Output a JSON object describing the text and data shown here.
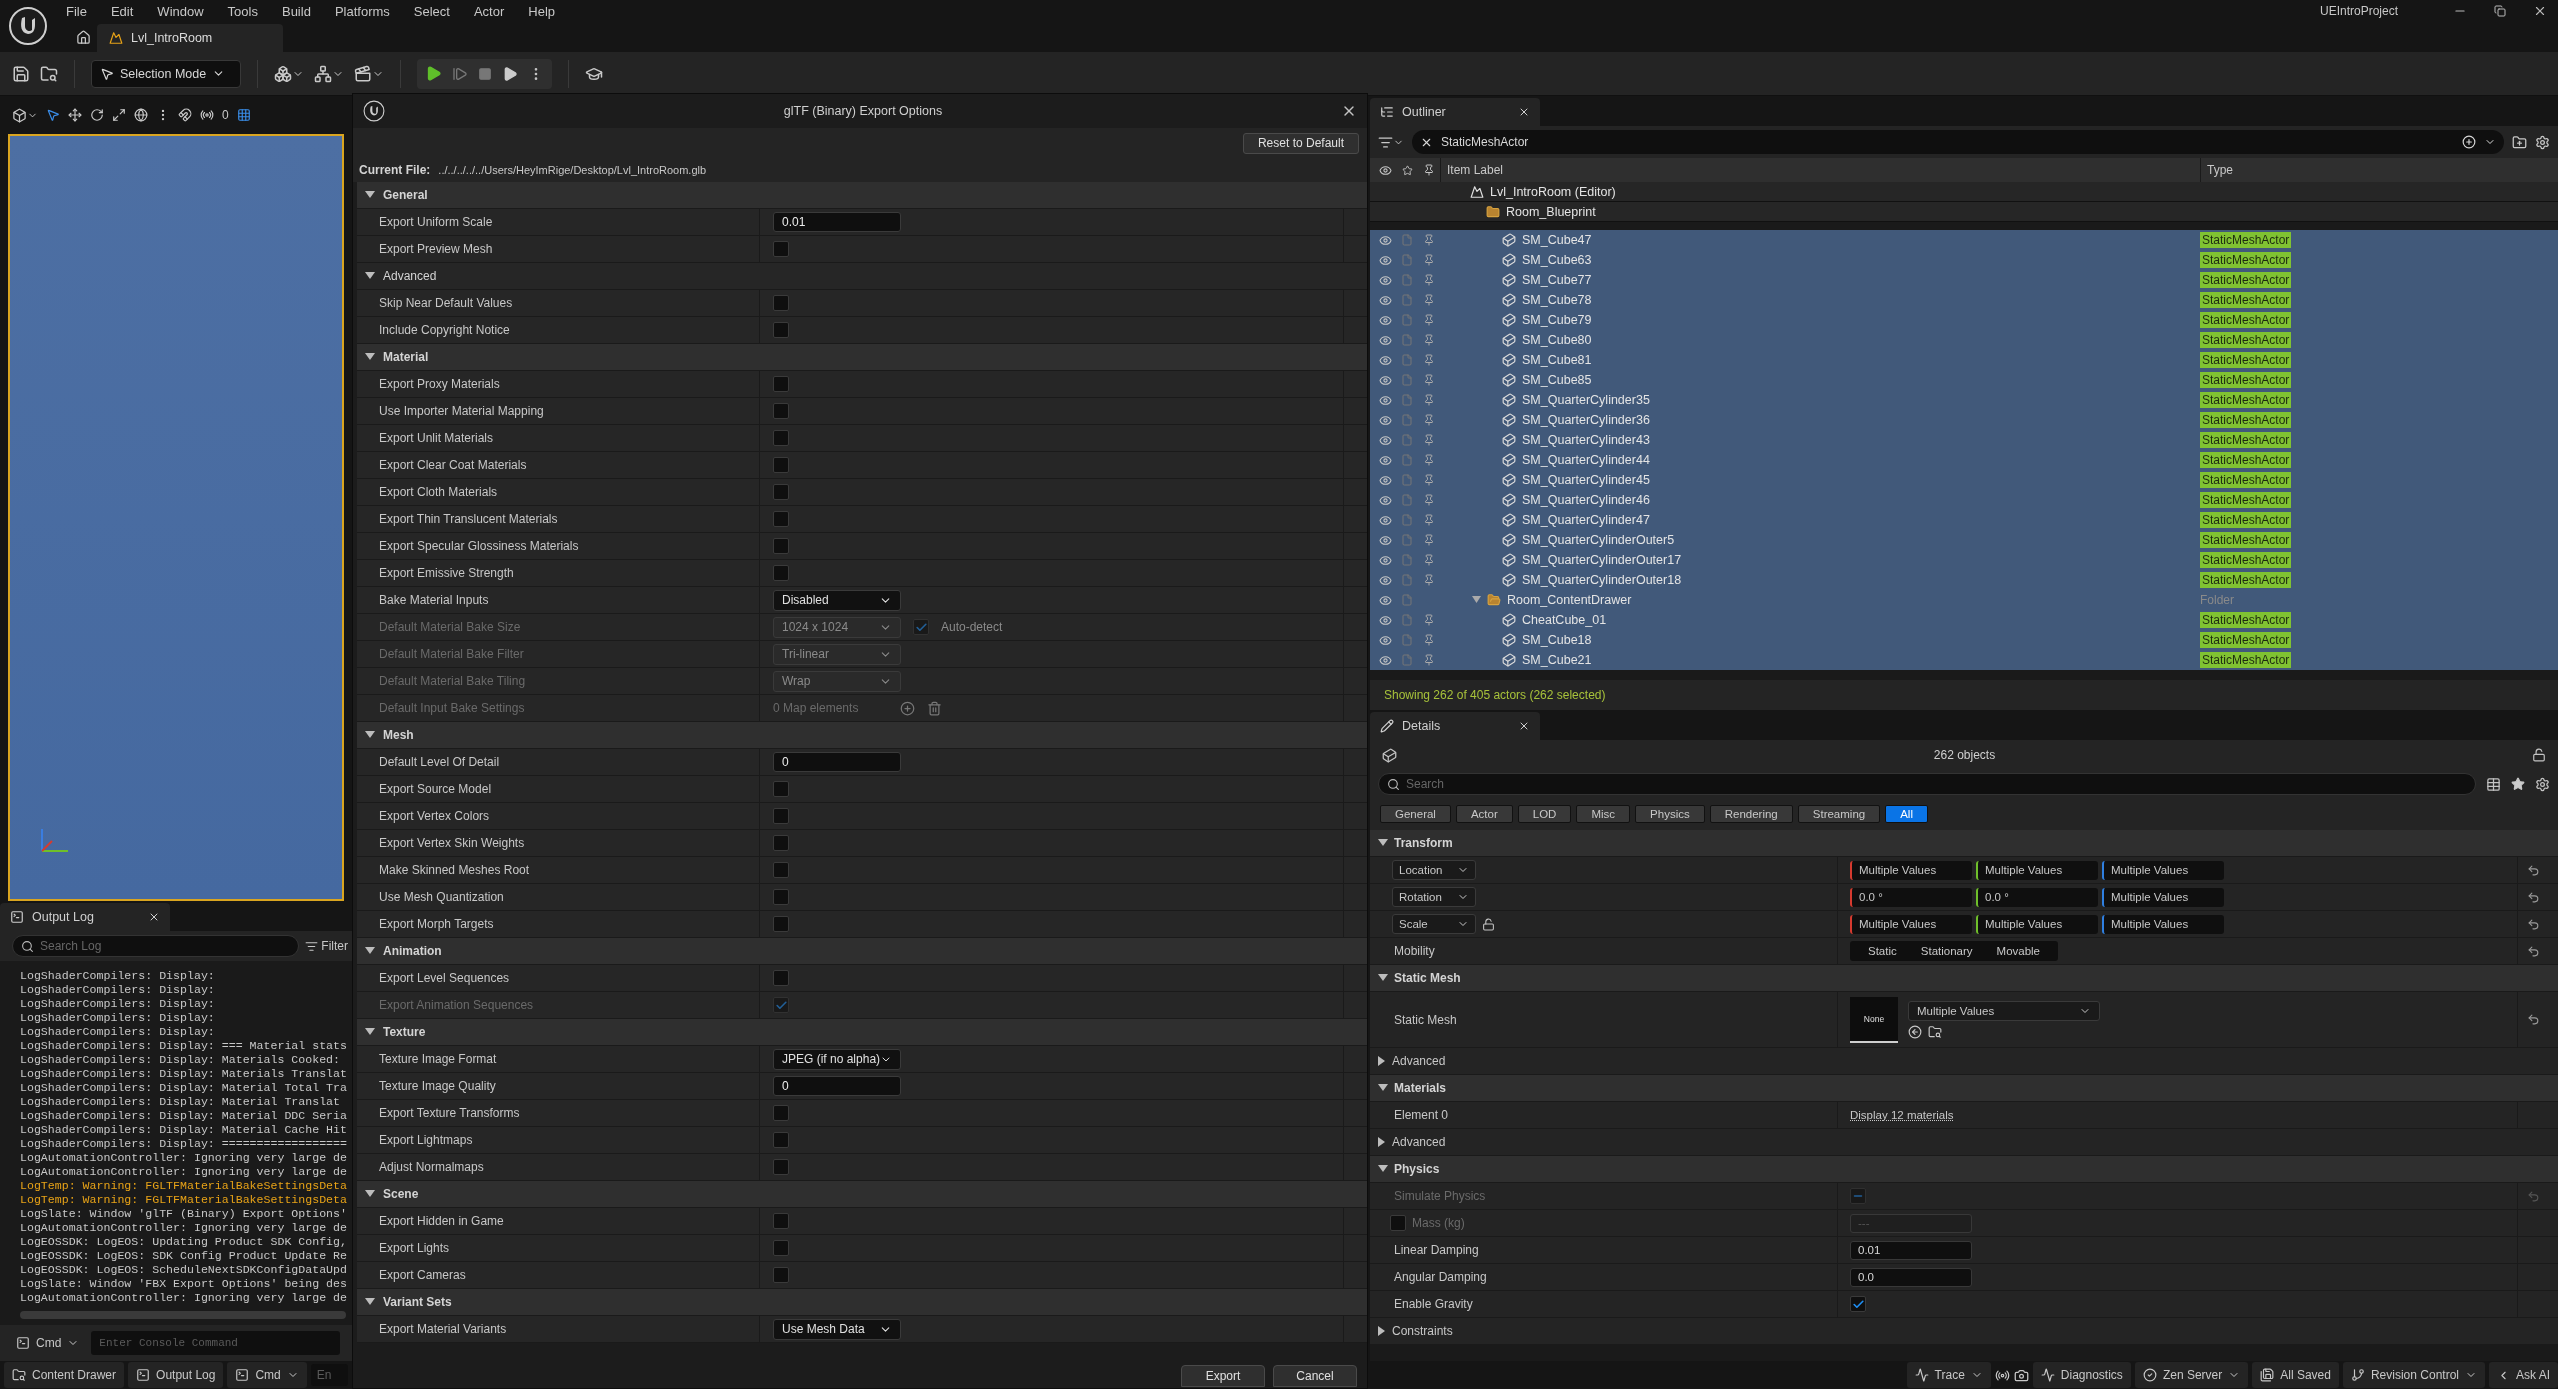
{
  "menu": [
    "File",
    "Edit",
    "Window",
    "Tools",
    "Build",
    "Platforms",
    "Select",
    "Actor",
    "Help"
  ],
  "project_title": "UEIntroProject",
  "level_tab": {
    "label": "Lvl_IntroRoom"
  },
  "toolbar": {
    "mode": "Selection Mode"
  },
  "viewport": {
    "snap_value": "0"
  },
  "output_log": {
    "title": "Output Log",
    "search_placeholder": "Search Log",
    "filter": "Filter",
    "cmd": "Cmd",
    "console_placeholder": "Enter Console Command",
    "lines": [
      {
        "kind": "info",
        "text": "LogShaderCompilers: Display:"
      },
      {
        "kind": "info",
        "text": "LogShaderCompilers: Display:"
      },
      {
        "kind": "info",
        "text": "LogShaderCompilers: Display:"
      },
      {
        "kind": "info",
        "text": "LogShaderCompilers: Display:"
      },
      {
        "kind": "info",
        "text": "LogShaderCompilers: Display:"
      },
      {
        "kind": "info",
        "text": "LogShaderCompilers: Display: === Material stats"
      },
      {
        "kind": "info",
        "text": "LogShaderCompilers: Display: Materials Cooked:"
      },
      {
        "kind": "info",
        "text": "LogShaderCompilers: Display: Materials Translat"
      },
      {
        "kind": "info",
        "text": "LogShaderCompilers: Display: Material Total Tra"
      },
      {
        "kind": "info",
        "text": "LogShaderCompilers: Display: Material Translat"
      },
      {
        "kind": "info",
        "text": "LogShaderCompilers: Display: Material DDC Seria"
      },
      {
        "kind": "info",
        "text": "LogShaderCompilers: Display: Material Cache Hit"
      },
      {
        "kind": "info",
        "text": "LogShaderCompilers: Display: =================="
      },
      {
        "kind": "info",
        "text": "LogAutomationController: Ignoring very large de"
      },
      {
        "kind": "info",
        "text": "LogAutomationController: Ignoring very large de"
      },
      {
        "kind": "warning",
        "text": "LogTemp: Warning: FGLTFMaterialBakeSettingsDeta"
      },
      {
        "kind": "warning",
        "text": "LogTemp: Warning: FGLTFMaterialBakeSettingsDeta"
      },
      {
        "kind": "info",
        "text": "LogSlate: Window 'glTF (Binary) Export Options'"
      },
      {
        "kind": "info",
        "text": "LogAutomationController: Ignoring very large de"
      },
      {
        "kind": "info",
        "text": "LogEOSSDK: LogEOS: Updating Product SDK Config,"
      },
      {
        "kind": "info",
        "text": "LogEOSSDK: LogEOS: SDK Config Product Update Re"
      },
      {
        "kind": "info",
        "text": "LogEOSSDK: LogEOS: ScheduleNextSDKConfigDataUpd"
      },
      {
        "kind": "info",
        "text": "LogSlate: Window 'FBX Export Options' being des"
      },
      {
        "kind": "info",
        "text": "LogAutomationController: Ignoring very large de"
      }
    ]
  },
  "dialog": {
    "title": "glTF (Binary) Export Options",
    "reset": "Reset to Default",
    "current_file_label": "Current File:",
    "current_file": "../../../../../Users/HeyImRige/Desktop/Lvl_IntroRoom.glb",
    "rows": [
      {
        "kind": "section",
        "label": "General"
      },
      {
        "kind": "text",
        "label": "Export Uniform Scale",
        "value": "0.01",
        "disabled": false
      },
      {
        "kind": "check",
        "label": "Export Preview Mesh",
        "checked": false,
        "disabled": false
      },
      {
        "kind": "subsection",
        "label": "Advanced"
      },
      {
        "kind": "check",
        "label": "Skip Near Default Values",
        "checked": false,
        "disabled": false
      },
      {
        "kind": "check",
        "label": "Include Copyright Notice",
        "checked": false,
        "disabled": false
      },
      {
        "kind": "section",
        "label": "Material"
      },
      {
        "kind": "check",
        "label": "Export Proxy Materials",
        "checked": false,
        "disabled": false
      },
      {
        "kind": "check",
        "label": "Use Importer Material Mapping",
        "checked": false,
        "disabled": false
      },
      {
        "kind": "check",
        "label": "Export Unlit Materials",
        "checked": false,
        "disabled": false
      },
      {
        "kind": "check",
        "label": "Export Clear Coat Materials",
        "checked": false,
        "disabled": false
      },
      {
        "kind": "check",
        "label": "Export Cloth Materials",
        "checked": false,
        "disabled": false
      },
      {
        "kind": "check",
        "label": "Export Thin Translucent Materials",
        "checked": false,
        "disabled": false
      },
      {
        "kind": "check",
        "label": "Export Specular Glossiness Materials",
        "checked": false,
        "disabled": false
      },
      {
        "kind": "check",
        "label": "Export Emissive Strength",
        "checked": false,
        "disabled": false
      },
      {
        "kind": "select",
        "label": "Bake Material Inputs",
        "value": "Disabled",
        "disabled": false
      },
      {
        "kind": "select_auto",
        "label": "Default Material Bake Size",
        "value": "1024 x 1024",
        "auto_label": "Auto-detect",
        "auto_checked": true,
        "disabled": true
      },
      {
        "kind": "select",
        "label": "Default Material Bake Filter",
        "value": "Tri-linear",
        "disabled": true
      },
      {
        "kind": "select",
        "label": "Default Material Bake Tiling",
        "value": "Wrap",
        "disabled": true
      },
      {
        "kind": "map",
        "label": "Default Input Bake Settings",
        "value": "0 Map elements",
        "disabled": true
      },
      {
        "kind": "section",
        "label": "Mesh"
      },
      {
        "kind": "text",
        "label": "Default Level Of Detail",
        "value": "0",
        "disabled": false
      },
      {
        "kind": "check",
        "label": "Export Source Model",
        "checked": false,
        "disabled": false
      },
      {
        "kind": "check",
        "label": "Export Vertex Colors",
        "checked": false,
        "disabled": false
      },
      {
        "kind": "check",
        "label": "Export Vertex Skin Weights",
        "checked": false,
        "disabled": false
      },
      {
        "kind": "check",
        "label": "Make Skinned Meshes Root",
        "checked": false,
        "disabled": false
      },
      {
        "kind": "check",
        "label": "Use Mesh Quantization",
        "checked": false,
        "disabled": false
      },
      {
        "kind": "check",
        "label": "Export Morph Targets",
        "checked": false,
        "disabled": false
      },
      {
        "kind": "section",
        "label": "Animation"
      },
      {
        "kind": "check",
        "label": "Export Level Sequences",
        "checked": false,
        "disabled": false
      },
      {
        "kind": "check",
        "label": "Export Animation Sequences",
        "checked": true,
        "disabled": true
      },
      {
        "kind": "section",
        "label": "Texture"
      },
      {
        "kind": "select",
        "label": "Texture Image Format",
        "value": "JPEG (if no alpha)",
        "disabled": false
      },
      {
        "kind": "text",
        "label": "Texture Image Quality",
        "value": "0",
        "disabled": false
      },
      {
        "kind": "check",
        "label": "Export Texture Transforms",
        "checked": false,
        "disabled": false
      },
      {
        "kind": "check",
        "label": "Export Lightmaps",
        "checked": false,
        "disabled": false
      },
      {
        "kind": "check",
        "label": "Adjust Normalmaps",
        "checked": false,
        "disabled": false
      },
      {
        "kind": "section",
        "label": "Scene"
      },
      {
        "kind": "check",
        "label": "Export Hidden in Game",
        "checked": false,
        "disabled": false
      },
      {
        "kind": "check",
        "label": "Export Lights",
        "checked": false,
        "disabled": false
      },
      {
        "kind": "check",
        "label": "Export Cameras",
        "checked": false,
        "disabled": false
      },
      {
        "kind": "section",
        "label": "Variant Sets"
      },
      {
        "kind": "select",
        "label": "Export Material Variants",
        "value": "Use Mesh Data",
        "disabled": false
      }
    ],
    "buttons": [
      "Export",
      "Cancel"
    ]
  },
  "outliner": {
    "title": "Outliner",
    "search": "StaticMeshActor",
    "columns": [
      "Item Label",
      "Type"
    ],
    "tree": [
      {
        "kind": "level",
        "label": "Lvl_IntroRoom (Editor)",
        "selected": false,
        "children": [
          {
            "kind": "folder",
            "label": "Room_Blueprint",
            "selected": false,
            "children": [
              {
                "kind": "actor",
                "label": "SM_Cube47",
                "type": "StaticMeshActor",
                "selected": true
              },
              {
                "kind": "actor",
                "label": "SM_Cube63",
                "type": "StaticMeshActor",
                "selected": true
              },
              {
                "kind": "actor",
                "label": "SM_Cube77",
                "type": "StaticMeshActor",
                "selected": true
              },
              {
                "kind": "actor",
                "label": "SM_Cube78",
                "type": "StaticMeshActor",
                "selected": true
              },
              {
                "kind": "actor",
                "label": "SM_Cube79",
                "type": "StaticMeshActor",
                "selected": true
              },
              {
                "kind": "actor",
                "label": "SM_Cube80",
                "type": "StaticMeshActor",
                "selected": true
              },
              {
                "kind": "actor",
                "label": "SM_Cube81",
                "type": "StaticMeshActor",
                "selected": true
              },
              {
                "kind": "actor",
                "label": "SM_Cube85",
                "type": "StaticMeshActor",
                "selected": true
              },
              {
                "kind": "actor",
                "label": "SM_QuarterCylinder35",
                "type": "StaticMeshActor",
                "selected": true
              },
              {
                "kind": "actor",
                "label": "SM_QuarterCylinder36",
                "type": "StaticMeshActor",
                "selected": true
              },
              {
                "kind": "actor",
                "label": "SM_QuarterCylinder43",
                "type": "StaticMeshActor",
                "selected": true
              },
              {
                "kind": "actor",
                "label": "SM_QuarterCylinder44",
                "type": "StaticMeshActor",
                "selected": true
              },
              {
                "kind": "actor",
                "label": "SM_QuarterCylinder45",
                "type": "StaticMeshActor",
                "selected": true
              },
              {
                "kind": "actor",
                "label": "SM_QuarterCylinder46",
                "type": "StaticMeshActor",
                "selected": true
              },
              {
                "kind": "actor",
                "label": "SM_QuarterCylinder47",
                "type": "StaticMeshActor",
                "selected": true
              },
              {
                "kind": "actor",
                "label": "SM_QuarterCylinderOuter5",
                "type": "StaticMeshActor",
                "selected": true
              },
              {
                "kind": "actor",
                "label": "SM_QuarterCylinderOuter17",
                "type": "StaticMeshActor",
                "selected": true
              },
              {
                "kind": "actor",
                "label": "SM_QuarterCylinderOuter18",
                "type": "StaticMeshActor",
                "selected": true
              }
            ]
          },
          {
            "kind": "folder",
            "label": "Room_ContentDrawer",
            "type": "Folder",
            "expanded": true,
            "selected": true,
            "children": [
              {
                "kind": "actor",
                "label": "CheatCube_01",
                "type": "StaticMeshActor",
                "selected": true
              },
              {
                "kind": "actor",
                "label": "SM_Cube18",
                "type": "StaticMeshActor",
                "selected": true
              },
              {
                "kind": "actor",
                "label": "SM_Cube21",
                "type": "StaticMeshActor",
                "selected": true
              }
            ]
          }
        ]
      }
    ],
    "status": "Showing 262 of 405 actors (262 selected)"
  },
  "details": {
    "title": "Details",
    "count": "262 objects",
    "search_placeholder": "Search",
    "filters": [
      {
        "label": "General",
        "selected": false
      },
      {
        "label": "Actor",
        "selected": false
      },
      {
        "label": "LOD",
        "selected": false
      },
      {
        "label": "Misc",
        "selected": false
      },
      {
        "label": "Physics",
        "selected": false
      },
      {
        "label": "Rendering",
        "selected": false
      },
      {
        "label": "Streaming",
        "selected": false
      },
      {
        "label": "All",
        "selected": true
      }
    ],
    "rows": [
      {
        "kind": "section",
        "label": "Transform"
      },
      {
        "kind": "vector",
        "label": "Location",
        "values": [
          "Multiple Values",
          "Multiple Values",
          "Multiple Values"
        ]
      },
      {
        "kind": "vector",
        "label": "Rotation",
        "values": [
          "0.0 °",
          "0.0 °",
          "Multiple Values"
        ]
      },
      {
        "kind": "vector",
        "label": "Scale",
        "lock": true,
        "values": [
          "Multiple Values",
          "Multiple Values",
          "Multiple Values"
        ]
      },
      {
        "kind": "mobility",
        "label": "Mobility",
        "options": [
          {
            "label": "Static",
            "selected": false
          },
          {
            "label": "Stationary",
            "selected": false
          },
          {
            "label": "Movable",
            "selected": false
          }
        ]
      },
      {
        "kind": "section",
        "label": "Static Mesh"
      },
      {
        "kind": "mesh",
        "label": "Static Mesh",
        "thumb": "None",
        "value": "Multiple Values"
      },
      {
        "kind": "collapsed",
        "label": "Advanced"
      },
      {
        "kind": "section",
        "label": "Materials"
      },
      {
        "kind": "link",
        "label": "Element 0",
        "value": "Display 12 materials"
      },
      {
        "kind": "collapsed",
        "label": "Advanced"
      },
      {
        "kind": "section",
        "label": "Physics"
      },
      {
        "kind": "tristate",
        "label": "Simulate Physics",
        "undetermined": true,
        "disabled": true
      },
      {
        "kind": "mass",
        "label": "Mass (kg)",
        "placeholder": "---",
        "checked": false,
        "disabled": true
      },
      {
        "kind": "number",
        "label": "Linear Damping",
        "value": "0.01"
      },
      {
        "kind": "number",
        "label": "Angular Damping",
        "value": "0.0"
      },
      {
        "kind": "check",
        "label": "Enable Gravity",
        "checked": true,
        "disabled": false
      },
      {
        "kind": "collapsed",
        "label": "Constraints"
      }
    ]
  },
  "status_bar": {
    "left": [
      {
        "kind": "button",
        "label": "Content Drawer"
      },
      {
        "kind": "button",
        "label": "Output Log"
      },
      {
        "kind": "dropdown",
        "label": "Cmd"
      }
    ],
    "console_placeholder": "En",
    "right": [
      {
        "kind": "dropdown",
        "label": "Trace"
      },
      {
        "kind": "button",
        "label": "Diagnostics"
      },
      {
        "kind": "dropdown",
        "label": "Zen Server"
      },
      {
        "kind": "button",
        "label": "All Saved"
      },
      {
        "kind": "dropdown",
        "label": "Revision Control"
      },
      {
        "kind": "back",
        "label": "Ask AI"
      }
    ]
  }
}
